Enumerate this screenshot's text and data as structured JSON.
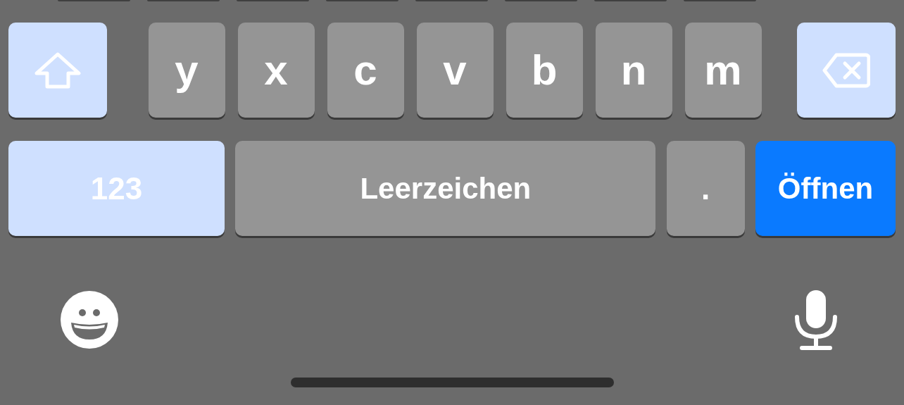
{
  "rows": [
    {
      "keys": [
        {
          "kind": "shift"
        },
        {
          "kind": "letter",
          "label": "y"
        },
        {
          "kind": "letter",
          "label": "x"
        },
        {
          "kind": "letter",
          "label": "c"
        },
        {
          "kind": "letter",
          "label": "v"
        },
        {
          "kind": "letter",
          "label": "b"
        },
        {
          "kind": "letter",
          "label": "n"
        },
        {
          "kind": "letter",
          "label": "m"
        },
        {
          "kind": "backspace"
        }
      ]
    },
    {
      "keys": [
        {
          "kind": "numbers",
          "label": "123"
        },
        {
          "kind": "space",
          "label": "Leerzeichen"
        },
        {
          "kind": "period",
          "label": "."
        },
        {
          "kind": "return",
          "label": "Öffnen"
        }
      ]
    }
  ],
  "bottom_buttons": [
    {
      "kind": "emoji"
    },
    {
      "kind": "dictation"
    }
  ]
}
